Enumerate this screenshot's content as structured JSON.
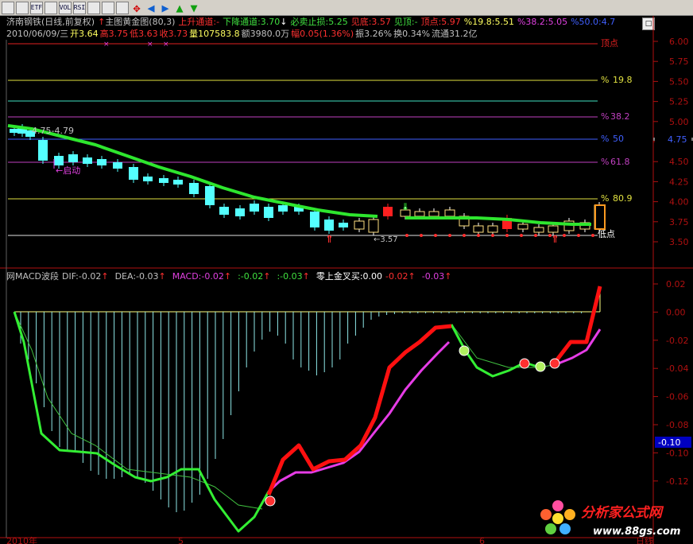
{
  "toolbar": {
    "buttons": [
      {
        "name": "toolbar-btn-1",
        "icon": "grid-icon",
        "label": ""
      },
      {
        "name": "toolbar-btn-2",
        "icon": "bars-icon",
        "label": ""
      },
      {
        "name": "toolbar-btn-3",
        "icon": "document-icon",
        "label": "ETF"
      },
      {
        "name": "toolbar-btn-4",
        "icon": "wave-icon",
        "label": ""
      },
      {
        "name": "toolbar-btn-5",
        "icon": "vol-icon",
        "label": "VOL"
      },
      {
        "name": "toolbar-btn-6",
        "icon": "rsi-icon",
        "label": "RSI"
      },
      {
        "name": "toolbar-btn-7",
        "icon": "window-icon",
        "label": ""
      },
      {
        "name": "toolbar-btn-8",
        "icon": "calendar-icon",
        "label": ""
      },
      {
        "name": "toolbar-btn-9",
        "icon": "window-icon",
        "label": ""
      }
    ],
    "arrows": [
      {
        "name": "arrow-pan-icon",
        "glyph": "✥",
        "color": "#d00000"
      },
      {
        "name": "arrow-left-icon",
        "glyph": "◀",
        "color": "#1060d0"
      },
      {
        "name": "arrow-right-icon",
        "glyph": "▶",
        "color": "#1060d0"
      },
      {
        "name": "arrow-up-icon",
        "glyph": "▲",
        "color": "#10a010"
      },
      {
        "name": "arrow-down-icon",
        "glyph": "▼",
        "color": "#10a010"
      }
    ]
  },
  "main_header": {
    "stock": "济南钢铁(日线,前复权)",
    "indicator_icon": "↑",
    "indicator": "主图黄金图(80,3)",
    "up_channel": "上升通道:-",
    "down_channel": "下降通道:3.70",
    "down_arrow": "↓",
    "must_sell": "必卖止损:5.25",
    "bottom_seen": "见底:3.57",
    "top_seen": "见顶:-",
    "top_point": "顶点:5.97",
    "pct_198": "%19.8:5.51",
    "pct_382": "%38.2:5.05",
    "pct_50": "%50.0:4.7"
  },
  "info_bar": {
    "date": "2010/06/09/三",
    "open": "开3.64",
    "high": "高3.75",
    "low": "低3.63",
    "close": "收3.73",
    "volume": "量107583.8",
    "amount": "额3980.0万",
    "change": "幅0.05(1.36%)",
    "amplitude": "振3.26%",
    "turnover": "换0.34%",
    "float": "流通31.2亿"
  },
  "macd_header": {
    "name": "网MACD波段",
    "dif": "DIF:-0.02",
    "dif_arrow": "↑",
    "dea": "DEA:-0.03",
    "dea_arrow": "↑",
    "macd": "MACD:-0.02",
    "macd_arrow": "↑",
    "v1": ":-0.02",
    "v1_arrow": "↑",
    "v2": ":-0.03",
    "v2_arrow": "↑",
    "cross": "零上金叉买:0.00",
    "v3": "-0.02",
    "v3_arrow": "↑",
    "v4": "-0.03",
    "v4_arrow": "↑"
  },
  "main_axis": {
    "ticks": [
      "6.00",
      "5.75",
      "5.50",
      "5.25",
      "5.00",
      "4.75",
      "4.50",
      "4.25",
      "4.00",
      "3.75",
      "3.50"
    ],
    "badge": "4.75"
  },
  "macd_axis": {
    "ticks": [
      "0.02",
      "0.00",
      "-0.02",
      "-0.04",
      "-0.06",
      "-0.08",
      "-0.10",
      "-0.12"
    ],
    "badge": "-0.10"
  },
  "annotations": {
    "top_point_label": "顶点",
    "fib_198": "19.8",
    "fib_382": "38.2",
    "fib_50": "50",
    "fib_618": "61.8",
    "fib_809": "80.9",
    "range_label": "4.75-4.79",
    "start_label": "启动",
    "low_marker_label": "3.57",
    "bottom_label": "低点",
    "pct_sign": "%"
  },
  "bottom_axis": {
    "year": "2010年",
    "m5": "5",
    "m6": "6",
    "right": "日线"
  },
  "watermark": {
    "title": "分析家公式网",
    "url": "www.88gs.com"
  },
  "colors": {
    "background": "#000000",
    "up_candle": "#ffffff",
    "down_candle": "#54ffff",
    "ma_line": "#2ee62e",
    "macd_red": "#ff1010",
    "macd_magenta": "#e63ce6",
    "dif_green": "#33ee33",
    "histogram": "#8fe8e8",
    "fib_yellow": "#e0e040",
    "fib_magenta": "#c040c0",
    "fib_blue": "#4060ff",
    "fib_red": "#e02020",
    "axis_border": "#b01010"
  }
}
